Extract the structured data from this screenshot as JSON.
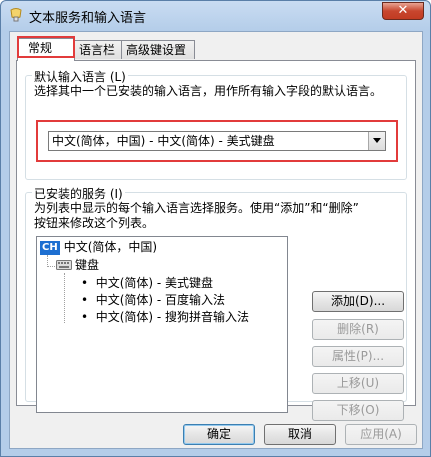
{
  "window": {
    "title": "文本服务和输入语言",
    "close_glyph": "✕"
  },
  "tabs": [
    {
      "label": "常规",
      "active": true
    },
    {
      "label": "语言栏",
      "active": false
    },
    {
      "label": "高级键设置",
      "active": false
    }
  ],
  "default_language": {
    "group_label": "默认输入语言 (L)",
    "description": "选择其中一个已安装的输入语言，用作所有输入字段的默认语言。",
    "selected": "中文(简体，中国) - 中文(简体) - 美式键盘"
  },
  "installed_services": {
    "group_label": "已安装的服务 (I)",
    "description_line1": "为列表中显示的每个输入语言选择服务。使用“添加”和“删除”",
    "description_line2": "按钮来修改这个列表。",
    "tree": {
      "language_badge": "CH",
      "language": "中文(简体，中国)",
      "category": "键盘",
      "items": [
        "中文(简体) - 美式键盘",
        "中文(简体) - 百度输入法",
        "中文(简体) - 搜狗拼音输入法"
      ],
      "bullet": "•"
    },
    "buttons": {
      "add": "添加(D)...",
      "remove": "删除(R)",
      "properties": "属性(P)...",
      "move_up": "上移(U)",
      "move_down": "下移(O)"
    }
  },
  "footer": {
    "ok": "确定",
    "cancel": "取消",
    "apply": "应用(A)"
  },
  "colors": {
    "highlight": "#e23b3b",
    "badge": "#1d6fd1"
  }
}
